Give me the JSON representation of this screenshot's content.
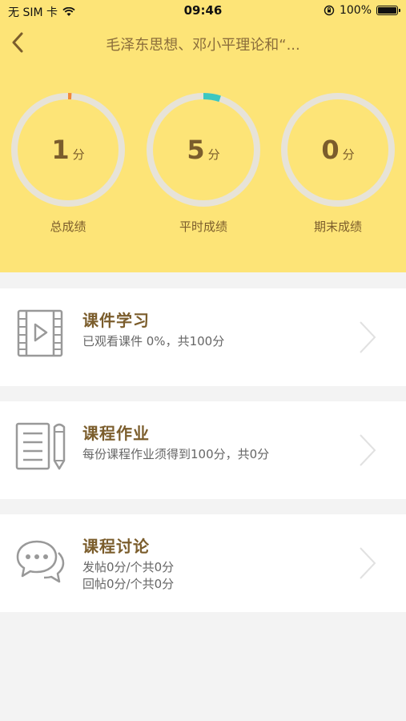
{
  "status_bar": {
    "carrier": "无 SIM 卡",
    "time": "09:46",
    "battery": "100%"
  },
  "nav": {
    "title": "毛泽东思想、邓小平理论和“..."
  },
  "scores": [
    {
      "label": "总成绩",
      "value": "1",
      "unit": "分",
      "arc_color": "#f0883a",
      "progress": 0.01
    },
    {
      "label": "平时成绩",
      "value": "5",
      "unit": "分",
      "arc_color": "#3dc7c0",
      "progress": 0.05
    },
    {
      "label": "期末成绩",
      "value": "0",
      "unit": "分",
      "arc_color": "#3dc7c0",
      "progress": 0
    }
  ],
  "sections": [
    {
      "title": "课件学习",
      "desc": [
        "已观看课件 0%，共100分"
      ]
    },
    {
      "title": "课程作业",
      "desc": [
        "每份课程作业须得到100分，共0分"
      ]
    },
    {
      "title": "课程讨论",
      "desc": [
        "发帖0分/个共0分",
        "回帖0分/个共0分"
      ]
    }
  ],
  "colors": {
    "header_bg": "#fde477",
    "accent_brown": "#7b5d2c",
    "ring_track": "#e7e3d8"
  }
}
